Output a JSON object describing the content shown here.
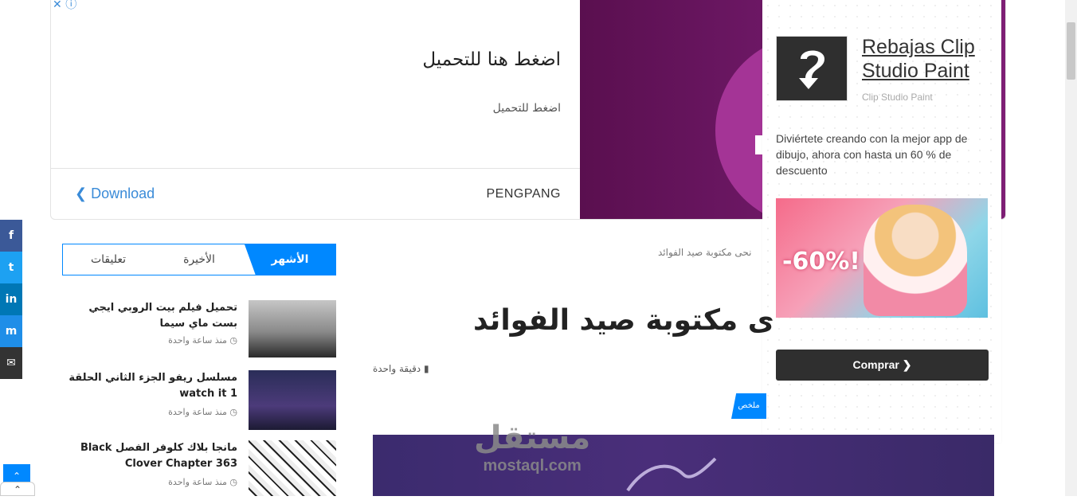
{
  "top_ad": {
    "close_glyph": "✕",
    "info_glyph": "ⓘ",
    "headline": "اضغط هنا للتحميل",
    "subline": "اضغط للتحميل",
    "download_label": "Download",
    "download_chevron": "❮",
    "advertiser": "PENGPANG"
  },
  "side_ad": {
    "title": "Rebajas Clip Studio Paint",
    "brand": "Clip Studio Paint",
    "description": "Diviértete creando con la mejor app de dibujo, ahora con hasta un 60 % de descuento",
    "image_text": "-60%!",
    "button_label": "Comprar",
    "button_chevron": "❯"
  },
  "share": {
    "facebook": "f",
    "twitter": "t",
    "linkedin": "in",
    "messenger": "m",
    "email": "✉",
    "back_to_top": "⌃",
    "collapse": "⌃"
  },
  "sidebar": {
    "tabs": [
      {
        "label": "الأشهر",
        "active": true
      },
      {
        "label": "الأخيرة",
        "active": false
      },
      {
        "label": "تعليقات",
        "active": false
      }
    ],
    "posts": [
      {
        "title": "تحميل فيلم بيت الروبي ايجي بست ماي سيما",
        "meta": "منذ ساعة واحدة"
      },
      {
        "title": "مسلسل ريفو الجزء الثاني الحلقة 1 watch it",
        "meta": "منذ ساعة واحدة"
      },
      {
        "title": "مانجا بلاك كلوفر الفصل Black Clover Chapter 363",
        "meta": "منذ ساعة واحدة"
      }
    ]
  },
  "article": {
    "breadcrumb": "نحى مكتوبة صيد الفوائد",
    "title": "ى مكتوبة صيد الفوائد",
    "read_time": "دقيقة واحدة",
    "category": "ملخص",
    "watermark_ar": "مستقل",
    "watermark_en": "mostaql.com"
  },
  "colors": {
    "accent": "#0088ff",
    "ad_purple": "#6b1763",
    "dark_button": "#2f2f2f"
  }
}
